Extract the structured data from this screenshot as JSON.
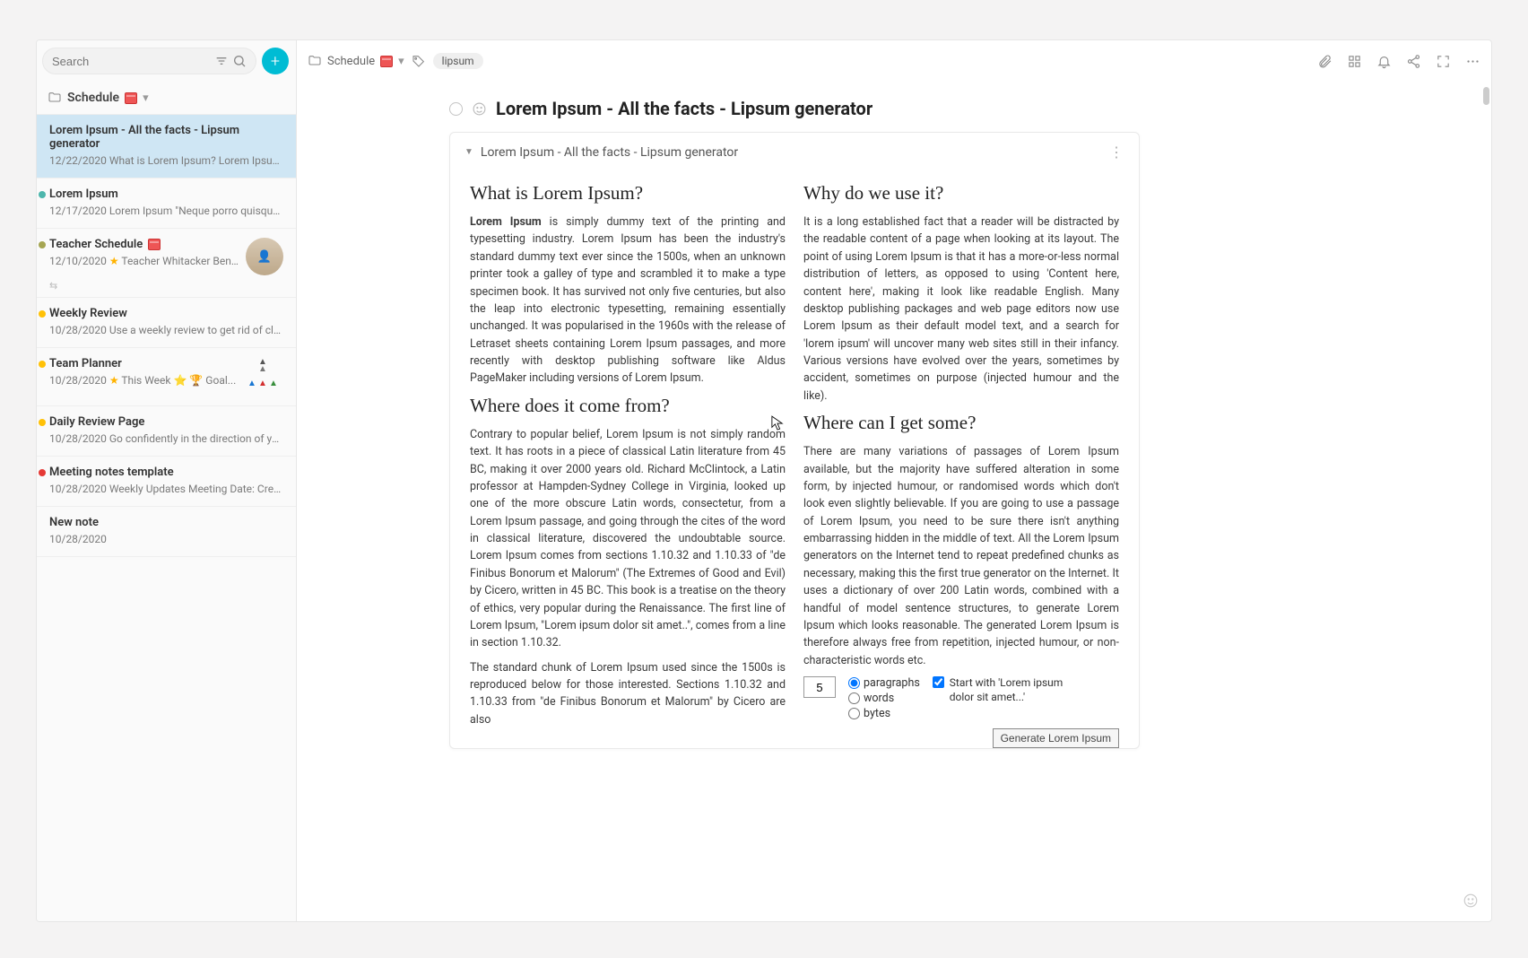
{
  "sidebar": {
    "search_placeholder": "Search",
    "folder_label": "Schedule",
    "notes": [
      {
        "title": "Lorem Ipsum - All the facts - Lipsum generator",
        "date": "12/22/2020",
        "excerpt": "What is Lorem Ipsum? Lorem Ipsum is si...",
        "dot": "",
        "active": true
      },
      {
        "title": "Lorem Ipsum",
        "date": "12/17/2020",
        "excerpt": "Lorem Ipsum \"Neque porro quisquam es...",
        "dot": "teal"
      },
      {
        "title": "Teacher Schedule",
        "date": "12/10/2020",
        "excerpt": "Teacher Whitacker Ben...",
        "dot": "olive",
        "avatar": true,
        "share_icon": true,
        "cal": true,
        "star_excerpt": true
      },
      {
        "title": "Weekly Review",
        "date": "10/28/2020",
        "excerpt": "Use a weekly review to get rid of clutter i...",
        "dot": "amber"
      },
      {
        "title": "Team Planner",
        "date": "10/28/2020",
        "excerpt": "This Week ⭐ 🏆 Goal...",
        "dot": "amber",
        "thumb": true,
        "star_excerpt": true
      },
      {
        "title": "Daily Review Page",
        "date": "10/28/2020",
        "excerpt": "Go confidently in the direction of your d...",
        "dot": "amber"
      },
      {
        "title": "Meeting notes template",
        "date": "10/28/2020",
        "excerpt": "Weekly Updates Meeting Date: Created ...",
        "dot": "red"
      },
      {
        "title": "New note",
        "date": "10/28/2020",
        "excerpt": "",
        "dot": ""
      }
    ]
  },
  "header": {
    "breadcrumb_folder": "Schedule",
    "tag": "lipsum"
  },
  "document": {
    "title": "Lorem Ipsum - All the facts - Lipsum generator",
    "card_title": "Lorem Ipsum - All the facts - Lipsum generator",
    "sections": {
      "s1_h": "What is Lorem Ipsum?",
      "s1_p": "Lorem Ipsum is simply dummy text of the printing and typesetting industry. Lorem Ipsum has been the industry's standard dummy text ever since the 1500s, when an unknown printer took a galley of type and scrambled it to make a type specimen book. It has survived not only five centuries, but also the leap into electronic typesetting, remaining essentially unchanged. It was popularised in the 1960s with the release of Letraset sheets containing Lorem Ipsum passages, and more recently with desktop publishing software like Aldus PageMaker including versions of Lorem Ipsum.",
      "s2_h": "Why do we use it?",
      "s2_p": "It is a long established fact that a reader will be distracted by the readable content of a page when looking at its layout. The point of using Lorem Ipsum is that it has a more-or-less normal distribution of letters, as opposed to using 'Content here, content here', making it look like readable English. Many desktop publishing packages and web page editors now use Lorem Ipsum as their default model text, and a search for 'lorem ipsum' will uncover many web sites still in their infancy. Various versions have evolved over the years, sometimes by accident, sometimes on purpose (injected humour and the like).",
      "s3_h": "Where does it come from?",
      "s3_p1": "Contrary to popular belief, Lorem Ipsum is not simply random text. It has roots in a piece of classical Latin literature from 45 BC, making it over 2000 years old. Richard McClintock, a Latin professor at Hampden-Sydney College in Virginia, looked up one of the more obscure Latin words, consectetur, from a Lorem Ipsum passage, and going through the cites of the word in classical literature, discovered the undoubtable source. Lorem Ipsum comes from sections 1.10.32 and 1.10.33 of \"de Finibus Bonorum et Malorum\" (The Extremes of Good and Evil) by Cicero, written in 45 BC. This book is a treatise on the theory of ethics, very popular during the Renaissance. The first line of Lorem Ipsum, \"Lorem ipsum dolor sit amet..\", comes from a line in section 1.10.32.",
      "s3_p2": "The standard chunk of Lorem Ipsum used since the 1500s is reproduced below for those interested. Sections 1.10.32 and 1.10.33 from \"de Finibus Bonorum et Malorum\" by Cicero are also",
      "s4_h": "Where can I get some?",
      "s4_p": "There are many variations of passages of Lorem Ipsum available, but the majority have suffered alteration in some form, by injected humour, or randomised words which don't look even slightly believable. If you are going to use a passage of Lorem Ipsum, you need to be sure there isn't anything embarrassing hidden in the middle of text. All the Lorem Ipsum generators on the Internet tend to repeat predefined chunks as necessary, making this the first true generator on the Internet. It uses a dictionary of over 200 Latin words, combined with a handful of model sentence structures, to generate Lorem Ipsum which looks reasonable. The generated Lorem Ipsum is therefore always free from repetition, injected humour, or non-characteristic words etc."
    },
    "form": {
      "count": "5",
      "opt_paragraphs": "paragraphs",
      "opt_words": "words",
      "opt_bytes": "bytes",
      "start_label": "Start with 'Lorem ipsum dolor sit amet...'",
      "generate_label": "Generate Lorem Ipsum"
    }
  }
}
